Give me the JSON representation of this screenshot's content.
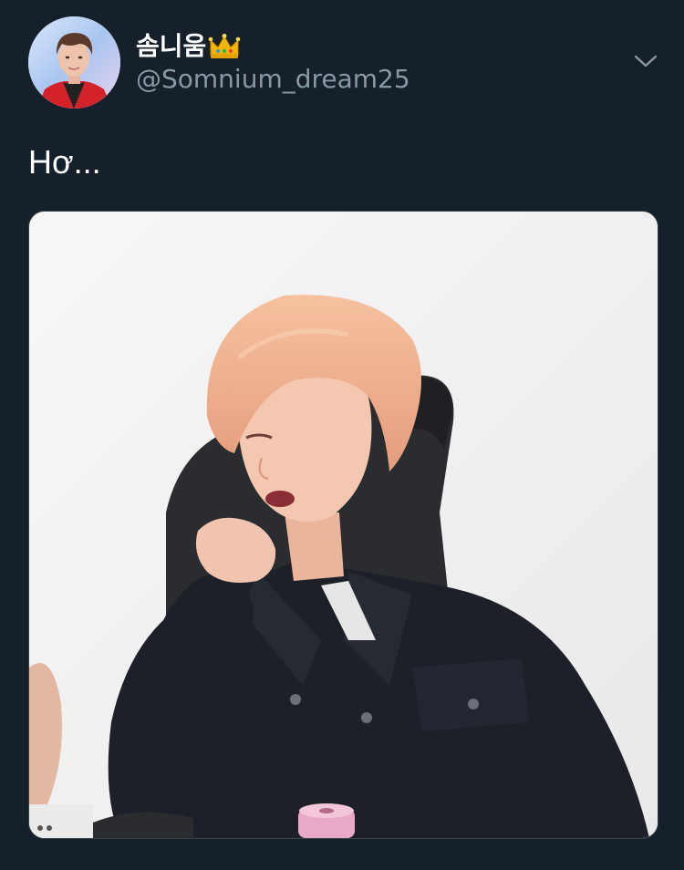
{
  "tweet": {
    "display_name": "솜니움",
    "handle": "@Somnium_dream25",
    "text": "Hơ...",
    "icons": {
      "avatar": "profile-photo",
      "name_badge": "crown-icon",
      "menu": "chevron-down-icon"
    },
    "media": {
      "kind": "photo"
    }
  },
  "colors": {
    "background": "#15202b",
    "primary_text": "#ffffff",
    "secondary_text": "#8899a6",
    "border": "#38444d"
  }
}
